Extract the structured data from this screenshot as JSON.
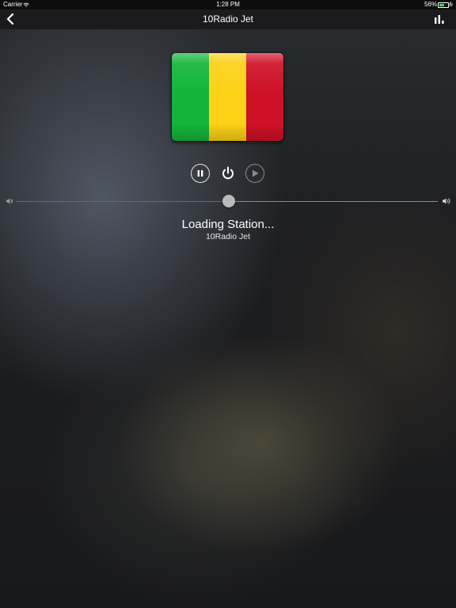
{
  "status_bar": {
    "carrier": "Carrier",
    "time": "1:28 PM",
    "battery_percent": "56%",
    "battery_level": 0.56,
    "icons": [
      "wifi-icon",
      "battery-icon",
      "charging-bolt-icon"
    ]
  },
  "nav": {
    "title": "10Radio Jet",
    "back_icon": "chevron-left-icon",
    "stats_icon": "bar-chart-icon"
  },
  "flag": {
    "name": "Mali",
    "stripe_colors": [
      "#14b53a",
      "#fcd116",
      "#ce1126"
    ]
  },
  "controls": {
    "buttons": [
      "pause-icon",
      "power-icon",
      "play-icon"
    ],
    "play_enabled": false
  },
  "volume": {
    "level": 0.505,
    "min_icon": "volume-low-icon",
    "max_icon": "volume-high-icon",
    "fill_color": "#2f73d8"
  },
  "player": {
    "status": "Loading Station...",
    "station_name": "10Radio Jet"
  }
}
